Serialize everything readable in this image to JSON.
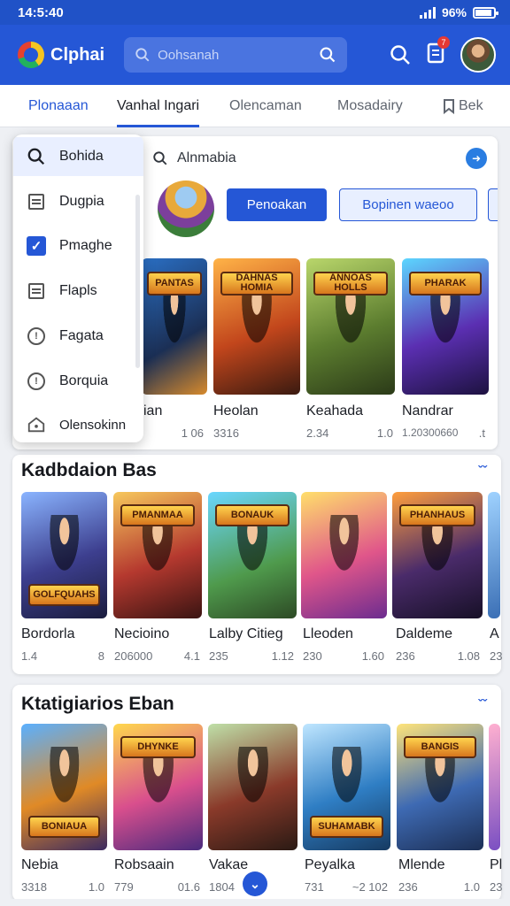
{
  "status": {
    "time": "14:5:40",
    "battery_text": "96%"
  },
  "header": {
    "brand": "Clphai",
    "search_placeholder": "Oohsanah",
    "notification_count": "7"
  },
  "tabs": [
    {
      "label": "Plonaaan"
    },
    {
      "label": "Vanhal Ingari"
    },
    {
      "label": "Olencaman"
    },
    {
      "label": "Mosadairy"
    },
    {
      "label": "Bek"
    }
  ],
  "dropdown": {
    "items": [
      {
        "label": "Bohida",
        "icon": "search-icon"
      },
      {
        "label": "Dugpia",
        "icon": "list-icon"
      },
      {
        "label": "Pmaghe",
        "icon": "checkbox-icon"
      },
      {
        "label": "Flapls",
        "icon": "list-icon"
      },
      {
        "label": "Fagata",
        "icon": "info-icon"
      },
      {
        "label": "Borquia",
        "icon": "info-icon"
      },
      {
        "label": "Olensokinn",
        "icon": "home-icon"
      }
    ]
  },
  "top_panel": {
    "search_value": "Alnmabia",
    "primary_button": "Penoakan",
    "secondary_button": "Bopinen waeoo",
    "banners": [
      "PANTAS",
      "DAHNAS HOMIA",
      "ANNOAS HOLLS",
      "PHARAK"
    ],
    "games": [
      {
        "name": "ian",
        "meta_left": "",
        "meta_right": "1 06"
      },
      {
        "name": "Heolan",
        "meta_left": "3316",
        "meta_right": ""
      },
      {
        "name": "Keahada",
        "meta_left": "2.34",
        "meta_right": "1.0"
      },
      {
        "name": "Nandrar",
        "meta_left": "1.20300660",
        "meta_right": ".t"
      }
    ]
  },
  "section1": {
    "title": "Kadbdaion Bas",
    "banners": [
      "GOLFQUAHS",
      "PMANMAA",
      "BONAUK",
      "",
      "PHANHAUS",
      ""
    ],
    "games": [
      {
        "name": "Bordorla",
        "meta_left": "1.4",
        "meta_right": "8"
      },
      {
        "name": "Necioino",
        "meta_left": "206000",
        "meta_right": "4.1"
      },
      {
        "name": "Lalby Citieg",
        "meta_left": "235",
        "meta_right": "1.12"
      },
      {
        "name": "Lleoden",
        "meta_left": "230",
        "meta_right": "1.60"
      },
      {
        "name": "Daldeme",
        "meta_left": "236",
        "meta_right": "1.08"
      },
      {
        "name": "A",
        "meta_left": "23",
        "meta_right": ""
      }
    ]
  },
  "section2": {
    "title": "Ktatigiarios Eban",
    "banners": [
      "BONIAUA",
      "DHYNKE",
      "",
      "SUHAMABK",
      "BANGIS",
      ""
    ],
    "games": [
      {
        "name": "Nebia",
        "meta_left": "3318",
        "meta_right": "1.0"
      },
      {
        "name": "Robsaain",
        "meta_left": "779",
        "meta_right": "01.6"
      },
      {
        "name": "Vakae",
        "meta_left": "1804",
        "meta_right": ""
      },
      {
        "name": "Peyalka",
        "meta_left": "731",
        "meta_right": "~2 102"
      },
      {
        "name": "Mlende",
        "meta_left": "236",
        "meta_right": "1.0"
      },
      {
        "name": "Pl",
        "meta_left": "23",
        "meta_right": ""
      }
    ]
  }
}
